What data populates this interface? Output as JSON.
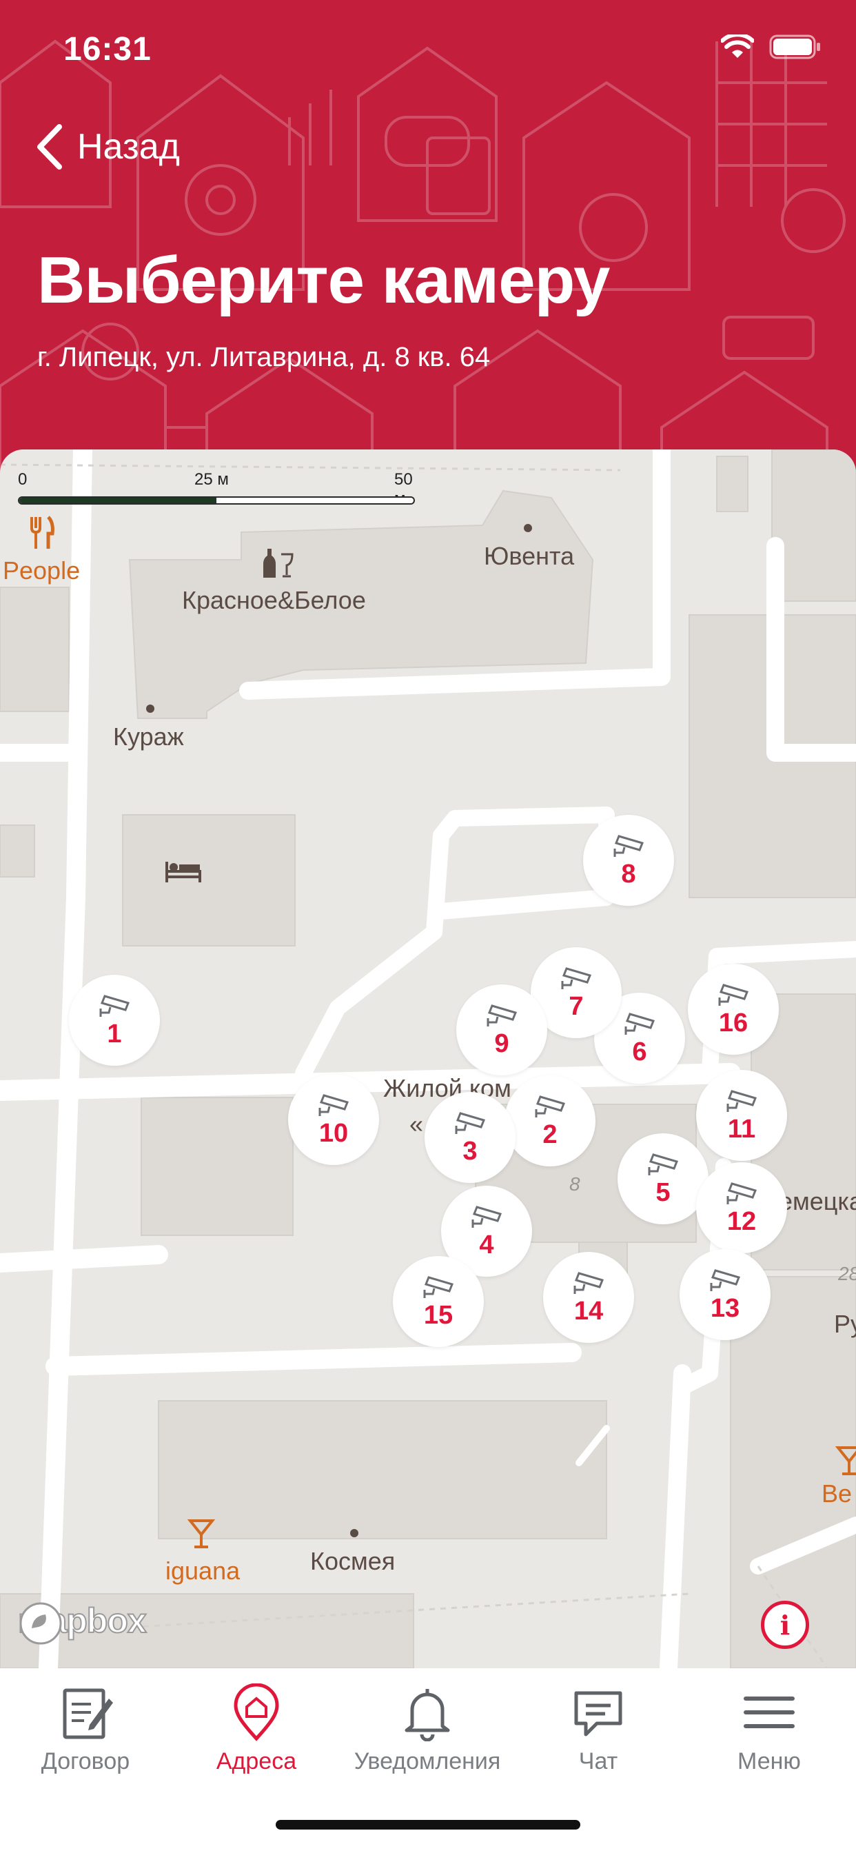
{
  "status_bar": {
    "time": "16:31"
  },
  "header": {
    "back_label": "Назад",
    "title": "Выберите камеру",
    "address": "г. Липецк, ул. Литаврина, д. 8 кв. 64"
  },
  "map": {
    "scale": {
      "labels": [
        "0",
        "25 м",
        "50 м"
      ]
    },
    "pois": {
      "people": "People",
      "krasnoe": "Красное&Белое",
      "yuventa": "Ювента",
      "kurazh": "Кураж",
      "zhiloy": "Жилой ком",
      "zhiloy_quote": "«",
      "house_number": "8",
      "nemecka": "емецка",
      "num28": "28",
      "ru": "Ру",
      "be": "Be",
      "iguana": "iguana",
      "kosmeya": "Космея"
    },
    "cameras": [
      "1",
      "2",
      "3",
      "4",
      "5",
      "6",
      "7",
      "8",
      "9",
      "10",
      "11",
      "12",
      "13",
      "14",
      "15",
      "16"
    ],
    "attribution": "mapbox",
    "info_label": "i"
  },
  "tabbar": {
    "tabs": [
      {
        "label": "Договор",
        "icon": "contract-icon"
      },
      {
        "label": "Адреса",
        "icon": "address-pin-icon",
        "active": true
      },
      {
        "label": "Уведомления",
        "icon": "bell-icon"
      },
      {
        "label": "Чат",
        "icon": "chat-icon"
      },
      {
        "label": "Меню",
        "icon": "menu-icon"
      }
    ]
  },
  "colors": {
    "brand": "#c31f3d",
    "accent": "#e0173a",
    "map_bg": "#eae8e5",
    "building": "#dedbd7",
    "road": "#ffffff"
  }
}
